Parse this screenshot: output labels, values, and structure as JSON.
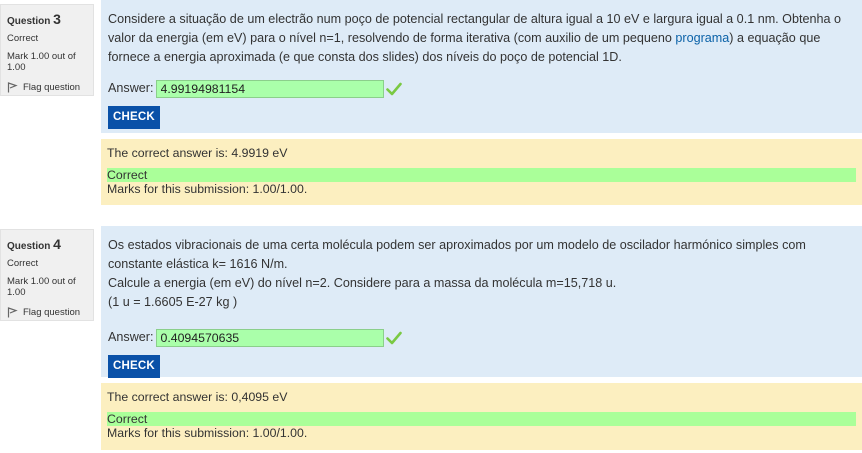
{
  "questions": [
    {
      "label": "Question",
      "number": "3",
      "state": "Correct",
      "grade": "Mark 1.00 out of 1.00",
      "flag_label": "Flag question",
      "text_before_link": "Considere a situação de um electrão num poço de potencial rectangular de altura igual a 10 eV e largura igual a 0.1 nm. Obtenha o valor da energia (em eV) para o nível n=1, resolvendo de forma iterativa (com auxilio de um pequeno ",
      "link_text": "programa",
      "text_after_link": ") a equação que fornece a energia aproximada (e que consta dos slides) dos níveis do poço de potencial 1D.",
      "answer_label": "Answer:",
      "answer_value": "4.99194981154",
      "check_label": "CHECK",
      "right_answer": "The correct answer is: 4.9919 eV",
      "feedback": "Correct",
      "marks": "Marks for this submission: 1.00/1.00."
    },
    {
      "label": "Question",
      "number": "4",
      "state": "Correct",
      "grade": "Mark 1.00 out of 1.00",
      "flag_label": "Flag question",
      "text_line1": "Os estados vibracionais de uma certa molécula podem ser aproximados por um modelo de oscilador harmónico simples com constante elástica k= 1616 N/m.",
      "text_line2": "Calcule a energia (em eV) do nível n=2. Considere para a massa da molécula m=15,718 u.",
      "text_line3": "(1 u = 1.6605 E-27 kg )",
      "answer_label": "Answer:",
      "answer_value": "0.4094570635",
      "check_label": "CHECK",
      "right_answer": "The correct answer is: 0,4095 eV",
      "feedback": "Correct",
      "marks": "Marks for this submission: 1.00/1.00."
    }
  ],
  "colors": {
    "formulation_bg": "#deebf7",
    "outcome_bg": "#fcefc0",
    "correct_input_bg": "#aaffaa",
    "correct_band_bg": "#aaff99",
    "check_button_bg": "#0a51a8",
    "tick_green": "#7ac943"
  }
}
